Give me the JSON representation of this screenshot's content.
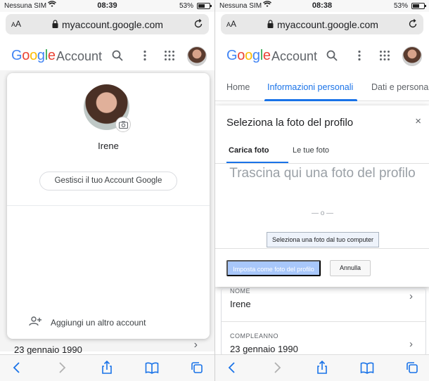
{
  "left": {
    "status": {
      "carrier": "Nessuna SIM",
      "time": "08:39",
      "battery": "53%"
    },
    "browser": {
      "aa_big": "A",
      "aa_small": "A",
      "url": "myaccount.google.com"
    },
    "header": {
      "logo": [
        "G",
        "o",
        "o",
        "g",
        "l",
        "e"
      ],
      "account": "Account"
    },
    "popup": {
      "name": "Irene",
      "manage_label": "Gestisci il tuo Account Google",
      "add_account_label": "Aggiungi un altro account"
    },
    "peek": {
      "date": "23 gennaio 1990"
    }
  },
  "right": {
    "status": {
      "carrier": "Nessuna SIM",
      "time": "08:38",
      "battery": "53%"
    },
    "browser": {
      "aa_big": "A",
      "aa_small": "A",
      "url": "myaccount.google.com"
    },
    "header": {
      "logo": [
        "G",
        "o",
        "o",
        "g",
        "l",
        "e"
      ],
      "account": "Account"
    },
    "tabs": [
      "Home",
      "Informazioni personali",
      "Dati e persona"
    ],
    "dialog": {
      "title": "Seleziona la foto del profilo",
      "close": "×",
      "tabs": [
        "Carica foto",
        "Le tue foto"
      ],
      "drop_text": "Trascina qui una foto del profilo",
      "or_text": "— o —",
      "select_button": "Seleziona una foto dal tuo computer",
      "set_button": "Imposta come foto del profilo",
      "cancel_button": "Annulla"
    },
    "fields": [
      {
        "label": "NOME",
        "value": "Irene"
      },
      {
        "label": "COMPLEANNO",
        "value": "23 gennaio 1990"
      }
    ]
  },
  "chevron": "›",
  "colors": {
    "accent": "#1a73e8",
    "google_blue": "#4285f4",
    "google_red": "#ea4335",
    "google_yellow": "#fbbc05",
    "google_green": "#34a853"
  }
}
